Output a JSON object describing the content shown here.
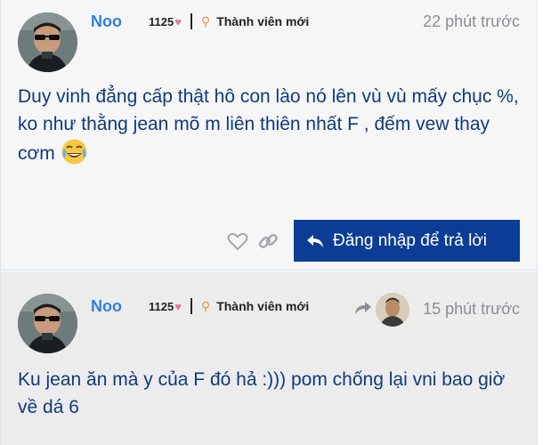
{
  "posts": [
    {
      "username": "Noo",
      "likes": "1125",
      "rank": "Thành viên mới",
      "time": "22 phút trước",
      "content": "Duy vinh đẳng cấp thật hô con lào nó lên vù vù mấy chục %, ko như thằng jean mõ m liên thiên nhất F , đếm vew thay cơm",
      "emoji": "joy-emoji"
    },
    {
      "username": "Noo",
      "likes": "1125",
      "rank": "Thành viên mới",
      "time": "15 phút trước",
      "content": "Ku jean ăn mà y của F đó hả :))) pom chống lại vni bao giờ về dá 6"
    }
  ],
  "actions": {
    "reply_label": "Đăng nhập để trả lời"
  },
  "colors": {
    "username": "#2f7fe3",
    "content_text": "#0f3a7c",
    "reply_button": "#0b3d96",
    "heart": "#e9748f",
    "rank_icon": "#d59a3e"
  },
  "icons": [
    "heart-icon",
    "rank-icon",
    "like-icon",
    "link-icon",
    "reply-icon",
    "reply-to-icon"
  ]
}
